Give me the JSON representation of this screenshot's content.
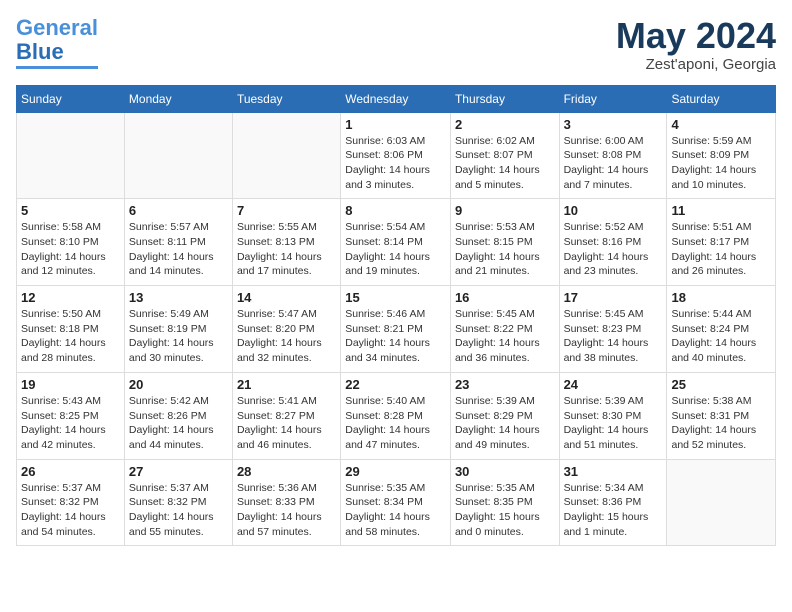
{
  "logo": {
    "line1": "General",
    "line2": "Blue"
  },
  "title": "May 2024",
  "location": "Zest'aponi, Georgia",
  "weekdays": [
    "Sunday",
    "Monday",
    "Tuesday",
    "Wednesday",
    "Thursday",
    "Friday",
    "Saturday"
  ],
  "weeks": [
    [
      {
        "day": "",
        "info": ""
      },
      {
        "day": "",
        "info": ""
      },
      {
        "day": "",
        "info": ""
      },
      {
        "day": "1",
        "info": "Sunrise: 6:03 AM\nSunset: 8:06 PM\nDaylight: 14 hours\nand 3 minutes."
      },
      {
        "day": "2",
        "info": "Sunrise: 6:02 AM\nSunset: 8:07 PM\nDaylight: 14 hours\nand 5 minutes."
      },
      {
        "day": "3",
        "info": "Sunrise: 6:00 AM\nSunset: 8:08 PM\nDaylight: 14 hours\nand 7 minutes."
      },
      {
        "day": "4",
        "info": "Sunrise: 5:59 AM\nSunset: 8:09 PM\nDaylight: 14 hours\nand 10 minutes."
      }
    ],
    [
      {
        "day": "5",
        "info": "Sunrise: 5:58 AM\nSunset: 8:10 PM\nDaylight: 14 hours\nand 12 minutes."
      },
      {
        "day": "6",
        "info": "Sunrise: 5:57 AM\nSunset: 8:11 PM\nDaylight: 14 hours\nand 14 minutes."
      },
      {
        "day": "7",
        "info": "Sunrise: 5:55 AM\nSunset: 8:13 PM\nDaylight: 14 hours\nand 17 minutes."
      },
      {
        "day": "8",
        "info": "Sunrise: 5:54 AM\nSunset: 8:14 PM\nDaylight: 14 hours\nand 19 minutes."
      },
      {
        "day": "9",
        "info": "Sunrise: 5:53 AM\nSunset: 8:15 PM\nDaylight: 14 hours\nand 21 minutes."
      },
      {
        "day": "10",
        "info": "Sunrise: 5:52 AM\nSunset: 8:16 PM\nDaylight: 14 hours\nand 23 minutes."
      },
      {
        "day": "11",
        "info": "Sunrise: 5:51 AM\nSunset: 8:17 PM\nDaylight: 14 hours\nand 26 minutes."
      }
    ],
    [
      {
        "day": "12",
        "info": "Sunrise: 5:50 AM\nSunset: 8:18 PM\nDaylight: 14 hours\nand 28 minutes."
      },
      {
        "day": "13",
        "info": "Sunrise: 5:49 AM\nSunset: 8:19 PM\nDaylight: 14 hours\nand 30 minutes."
      },
      {
        "day": "14",
        "info": "Sunrise: 5:47 AM\nSunset: 8:20 PM\nDaylight: 14 hours\nand 32 minutes."
      },
      {
        "day": "15",
        "info": "Sunrise: 5:46 AM\nSunset: 8:21 PM\nDaylight: 14 hours\nand 34 minutes."
      },
      {
        "day": "16",
        "info": "Sunrise: 5:45 AM\nSunset: 8:22 PM\nDaylight: 14 hours\nand 36 minutes."
      },
      {
        "day": "17",
        "info": "Sunrise: 5:45 AM\nSunset: 8:23 PM\nDaylight: 14 hours\nand 38 minutes."
      },
      {
        "day": "18",
        "info": "Sunrise: 5:44 AM\nSunset: 8:24 PM\nDaylight: 14 hours\nand 40 minutes."
      }
    ],
    [
      {
        "day": "19",
        "info": "Sunrise: 5:43 AM\nSunset: 8:25 PM\nDaylight: 14 hours\nand 42 minutes."
      },
      {
        "day": "20",
        "info": "Sunrise: 5:42 AM\nSunset: 8:26 PM\nDaylight: 14 hours\nand 44 minutes."
      },
      {
        "day": "21",
        "info": "Sunrise: 5:41 AM\nSunset: 8:27 PM\nDaylight: 14 hours\nand 46 minutes."
      },
      {
        "day": "22",
        "info": "Sunrise: 5:40 AM\nSunset: 8:28 PM\nDaylight: 14 hours\nand 47 minutes."
      },
      {
        "day": "23",
        "info": "Sunrise: 5:39 AM\nSunset: 8:29 PM\nDaylight: 14 hours\nand 49 minutes."
      },
      {
        "day": "24",
        "info": "Sunrise: 5:39 AM\nSunset: 8:30 PM\nDaylight: 14 hours\nand 51 minutes."
      },
      {
        "day": "25",
        "info": "Sunrise: 5:38 AM\nSunset: 8:31 PM\nDaylight: 14 hours\nand 52 minutes."
      }
    ],
    [
      {
        "day": "26",
        "info": "Sunrise: 5:37 AM\nSunset: 8:32 PM\nDaylight: 14 hours\nand 54 minutes."
      },
      {
        "day": "27",
        "info": "Sunrise: 5:37 AM\nSunset: 8:32 PM\nDaylight: 14 hours\nand 55 minutes."
      },
      {
        "day": "28",
        "info": "Sunrise: 5:36 AM\nSunset: 8:33 PM\nDaylight: 14 hours\nand 57 minutes."
      },
      {
        "day": "29",
        "info": "Sunrise: 5:35 AM\nSunset: 8:34 PM\nDaylight: 14 hours\nand 58 minutes."
      },
      {
        "day": "30",
        "info": "Sunrise: 5:35 AM\nSunset: 8:35 PM\nDaylight: 15 hours\nand 0 minutes."
      },
      {
        "day": "31",
        "info": "Sunrise: 5:34 AM\nSunset: 8:36 PM\nDaylight: 15 hours\nand 1 minute."
      },
      {
        "day": "",
        "info": ""
      }
    ]
  ]
}
